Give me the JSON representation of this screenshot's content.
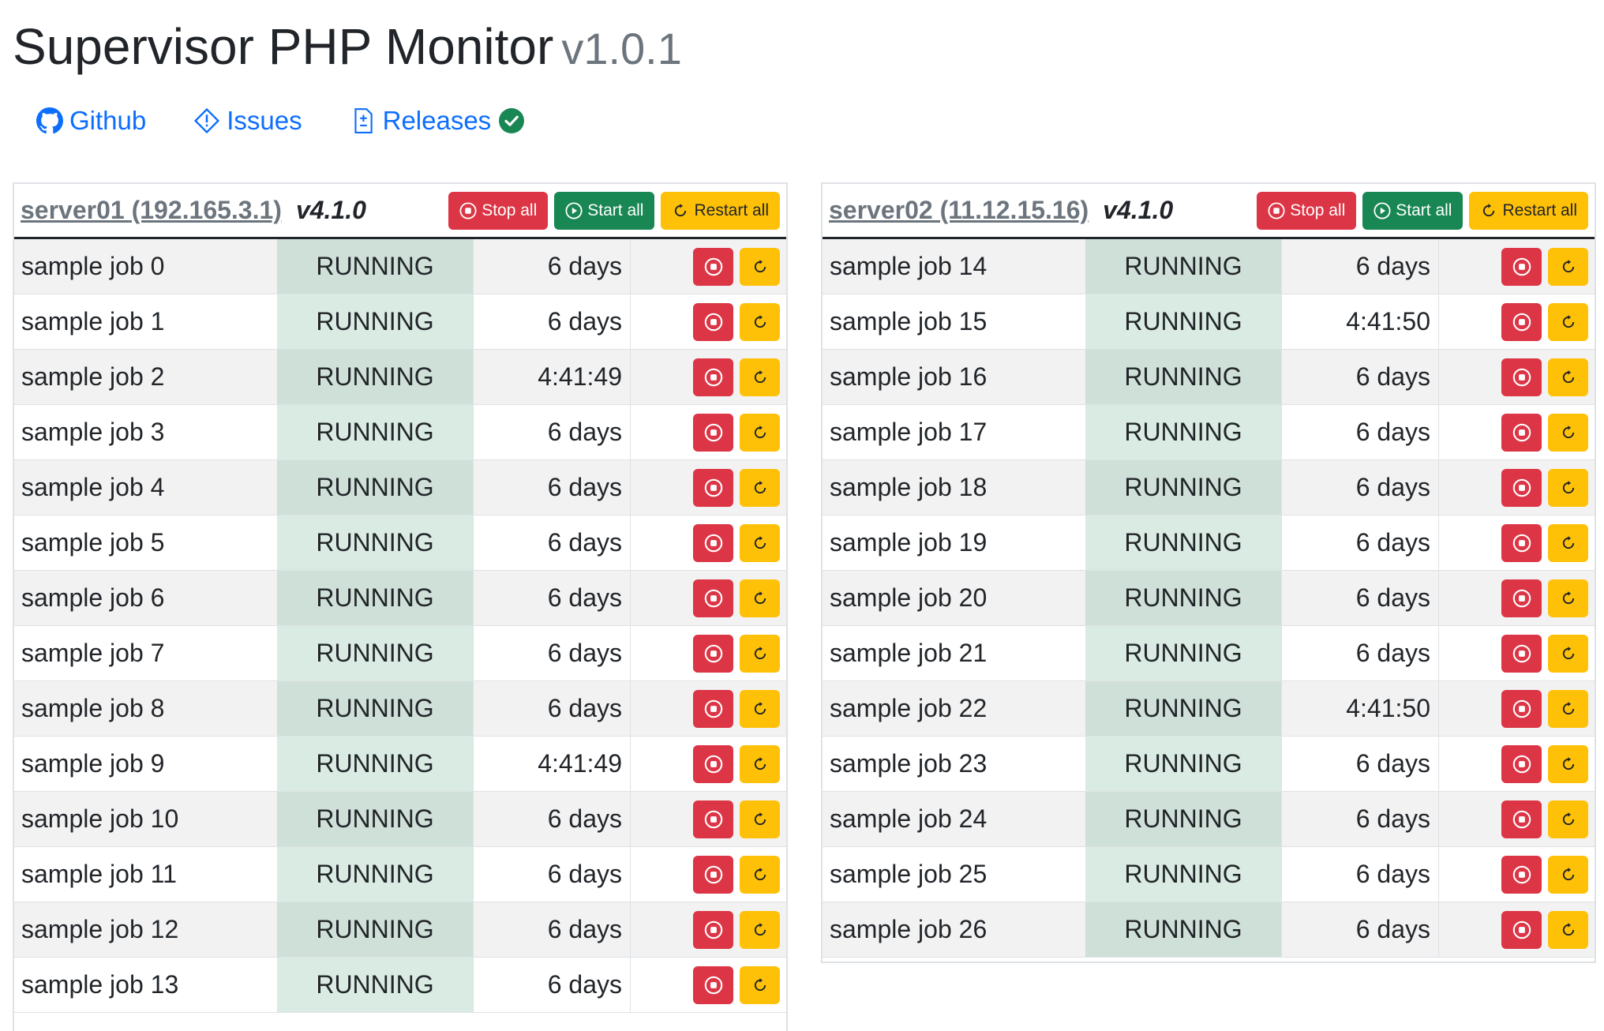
{
  "header": {
    "title": "Supervisor PHP Monitor",
    "version": "v1.0.1"
  },
  "links": [
    {
      "label": "Github",
      "icon": "github-icon"
    },
    {
      "label": "Issues",
      "icon": "issues-icon"
    },
    {
      "label": "Releases",
      "icon": "releases-icon",
      "status_icon": "check-circle-icon",
      "status_color": "#198754"
    }
  ],
  "colors": {
    "link": "#0d6efd",
    "stop": "#dc3545",
    "start": "#198754",
    "restart": "#ffc107",
    "running_bg": "#d1e7dd"
  },
  "buttons": {
    "stop_all": "Stop all",
    "start_all": "Start all",
    "restart_all": "Restart all"
  },
  "servers": [
    {
      "name": "server01 (192.165.3.1)",
      "version": "v4.1.0",
      "jobs": [
        {
          "name": "sample job 0",
          "state": "RUNNING",
          "uptime": "6 days"
        },
        {
          "name": "sample job 1",
          "state": "RUNNING",
          "uptime": "6 days"
        },
        {
          "name": "sample job 2",
          "state": "RUNNING",
          "uptime": "4:41:49"
        },
        {
          "name": "sample job 3",
          "state": "RUNNING",
          "uptime": "6 days"
        },
        {
          "name": "sample job 4",
          "state": "RUNNING",
          "uptime": "6 days"
        },
        {
          "name": "sample job 5",
          "state": "RUNNING",
          "uptime": "6 days"
        },
        {
          "name": "sample job 6",
          "state": "RUNNING",
          "uptime": "6 days"
        },
        {
          "name": "sample job 7",
          "state": "RUNNING",
          "uptime": "6 days"
        },
        {
          "name": "sample job 8",
          "state": "RUNNING",
          "uptime": "6 days"
        },
        {
          "name": "sample job 9",
          "state": "RUNNING",
          "uptime": "4:41:49"
        },
        {
          "name": "sample job 10",
          "state": "RUNNING",
          "uptime": "6 days"
        },
        {
          "name": "sample job 11",
          "state": "RUNNING",
          "uptime": "6 days"
        },
        {
          "name": "sample job 12",
          "state": "RUNNING",
          "uptime": "6 days"
        },
        {
          "name": "sample job 13",
          "state": "RUNNING",
          "uptime": "6 days"
        }
      ]
    },
    {
      "name": "server02 (11.12.15.16)",
      "version": "v4.1.0",
      "jobs": [
        {
          "name": "sample job 14",
          "state": "RUNNING",
          "uptime": "6 days"
        },
        {
          "name": "sample job 15",
          "state": "RUNNING",
          "uptime": "4:41:50"
        },
        {
          "name": "sample job 16",
          "state": "RUNNING",
          "uptime": "6 days"
        },
        {
          "name": "sample job 17",
          "state": "RUNNING",
          "uptime": "6 days"
        },
        {
          "name": "sample job 18",
          "state": "RUNNING",
          "uptime": "6 days"
        },
        {
          "name": "sample job 19",
          "state": "RUNNING",
          "uptime": "6 days"
        },
        {
          "name": "sample job 20",
          "state": "RUNNING",
          "uptime": "6 days"
        },
        {
          "name": "sample job 21",
          "state": "RUNNING",
          "uptime": "6 days"
        },
        {
          "name": "sample job 22",
          "state": "RUNNING",
          "uptime": "4:41:50"
        },
        {
          "name": "sample job 23",
          "state": "RUNNING",
          "uptime": "6 days"
        },
        {
          "name": "sample job 24",
          "state": "RUNNING",
          "uptime": "6 days"
        },
        {
          "name": "sample job 25",
          "state": "RUNNING",
          "uptime": "6 days"
        },
        {
          "name": "sample job 26",
          "state": "RUNNING",
          "uptime": "6 days"
        }
      ]
    }
  ]
}
